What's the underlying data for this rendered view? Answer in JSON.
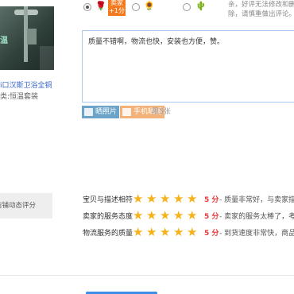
{
  "product": {
    "title": "i口汉斯卫浴全铜",
    "classification": "类:恒温套装",
    "image_watermark": "温"
  },
  "rating": {
    "options": [
      {
        "face": "🌹",
        "checked": true
      },
      {
        "face": "🌻",
        "checked": false
      },
      {
        "face": "🌵",
        "checked": false
      }
    ],
    "bubble_line1": "卖家",
    "bubble_line2": "+1分",
    "note": "亲，好评无法修改和删除，请慎重做出评论。"
  },
  "comment": {
    "value": "质量不错啊，物流也快，安装也方便，赞。"
  },
  "upload": {
    "photo_label": "晒照片",
    "phone_label": "手机晒图",
    "limit_label": "限5张"
  },
  "shop_dsr": {
    "label": "店铺动态评分",
    "rows": [
      {
        "label": "宝贝与描述相符",
        "score": "5 分",
        "desc": "- 质量非常好，与卖家描述"
      },
      {
        "label": "卖家的服务态度",
        "score": "5 分",
        "desc": "- 卖家的服务太棒了，考虑"
      },
      {
        "label": "物流服务的质量",
        "score": "5 分",
        "desc": "- 到货速度非常快，商品完"
      }
    ]
  }
}
